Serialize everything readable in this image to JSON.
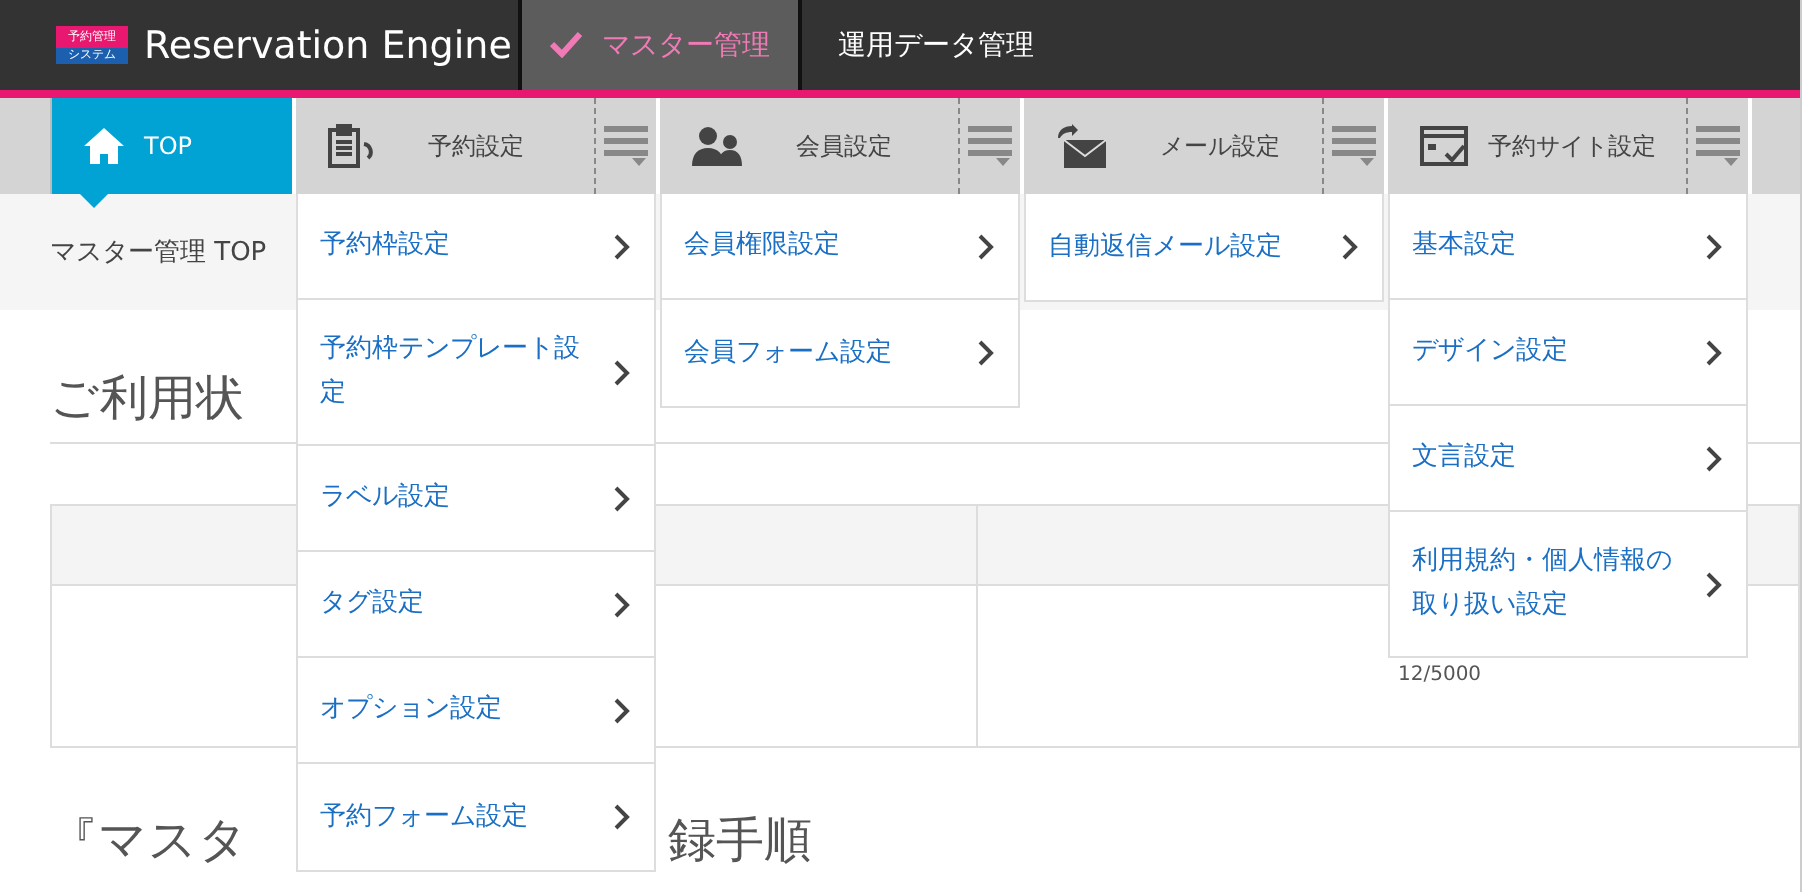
{
  "header": {
    "logo": {
      "top": "予約管理",
      "bottom": "システム"
    },
    "app_name": "Reservation Engine",
    "tabs": [
      {
        "label": "マスター管理",
        "selected": true
      },
      {
        "label": "運用データ管理",
        "selected": false
      }
    ]
  },
  "nav": [
    {
      "label": "TOP",
      "selected": true
    },
    {
      "label": "予約設定",
      "selected": false,
      "menu": [
        "予約枠設定",
        "予約枠テンプレート設定",
        "ラベル設定",
        "タグ設定",
        "オプション設定",
        "予約フォーム設定"
      ]
    },
    {
      "label": "会員設定",
      "selected": false,
      "menu": [
        "会員権限設定",
        "会員フォーム設定"
      ]
    },
    {
      "label": "メール設定",
      "selected": false,
      "menu": [
        "自動返信メール設定"
      ]
    },
    {
      "label": "予約サイト設定",
      "selected": false,
      "menu": [
        "基本設定",
        "デザイン設定",
        "文言設定",
        "利用規約・個人情報の取り扱い設定"
      ]
    }
  ],
  "breadcrumb": "マスター管理 TOP",
  "usage_heading": "ご利用状",
  "usage_table": {
    "cell": "12/5000"
  },
  "steps_heading": {
    "left": "『マスタ",
    "right": "録手順"
  }
}
